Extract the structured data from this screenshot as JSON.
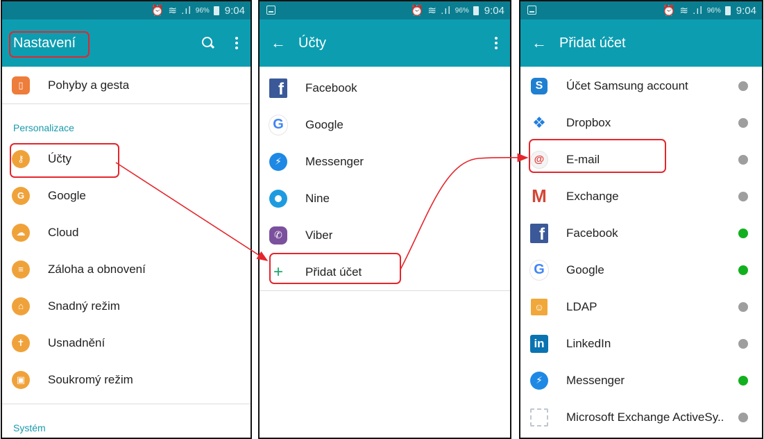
{
  "status_bar": {
    "battery": "96%",
    "time": "9:04"
  },
  "screen1": {
    "title": "Nastavení",
    "top_item": {
      "label": "Pohyby a gesta",
      "icon": "motions-icon"
    },
    "section_personalization": "Personalizace",
    "items": [
      {
        "label": "Účty",
        "icon": "key-icon",
        "glyph": "⚷"
      },
      {
        "label": "Google",
        "icon": "google-icon",
        "glyph": "G"
      },
      {
        "label": "Cloud",
        "icon": "cloud-icon",
        "glyph": "☁"
      },
      {
        "label": "Záloha a obnovení",
        "icon": "backup-icon",
        "glyph": "≡"
      },
      {
        "label": "Snadný režim",
        "icon": "easy-mode-icon",
        "glyph": "⌂"
      },
      {
        "label": "Usnadnění",
        "icon": "accessibility-icon",
        "glyph": "✝"
      },
      {
        "label": "Soukromý režim",
        "icon": "private-mode-icon",
        "glyph": "▣"
      }
    ],
    "section_system": "Systém"
  },
  "screen2": {
    "title": "Účty",
    "items": [
      {
        "label": "Facebook",
        "icon": "facebook-icon"
      },
      {
        "label": "Google",
        "icon": "google-icon"
      },
      {
        "label": "Messenger",
        "icon": "messenger-icon"
      },
      {
        "label": "Nine",
        "icon": "nine-icon"
      },
      {
        "label": "Viber",
        "icon": "viber-icon"
      }
    ],
    "add_account": "Přidat účet"
  },
  "screen3": {
    "title": "Přidat účet",
    "items": [
      {
        "label": "Účet Samsung account",
        "icon": "samsung-icon",
        "status": "inactive"
      },
      {
        "label": "Dropbox",
        "icon": "dropbox-icon",
        "status": "inactive"
      },
      {
        "label": "E-mail",
        "icon": "email-icon",
        "status": "inactive"
      },
      {
        "label": "Exchange",
        "icon": "gmail-icon",
        "status": "inactive"
      },
      {
        "label": "Facebook",
        "icon": "facebook-icon",
        "status": "active"
      },
      {
        "label": "Google",
        "icon": "google-icon",
        "status": "active"
      },
      {
        "label": "LDAP",
        "icon": "ldap-icon",
        "status": "inactive"
      },
      {
        "label": "LinkedIn",
        "icon": "linkedin-icon",
        "status": "inactive"
      },
      {
        "label": "Messenger",
        "icon": "messenger-icon",
        "status": "active"
      },
      {
        "label": "Microsoft Exchange ActiveSy..",
        "icon": "ms-exchange-icon",
        "status": "inactive"
      }
    ]
  },
  "colors": {
    "status_bar": "#0a7e90",
    "app_bar": "#0d9db1",
    "section_header": "#1a9aad",
    "highlight": "#e5252c",
    "dot_active": "#12b01e",
    "dot_inactive": "#9e9e9e",
    "settings_icon": "#f0a23a"
  }
}
